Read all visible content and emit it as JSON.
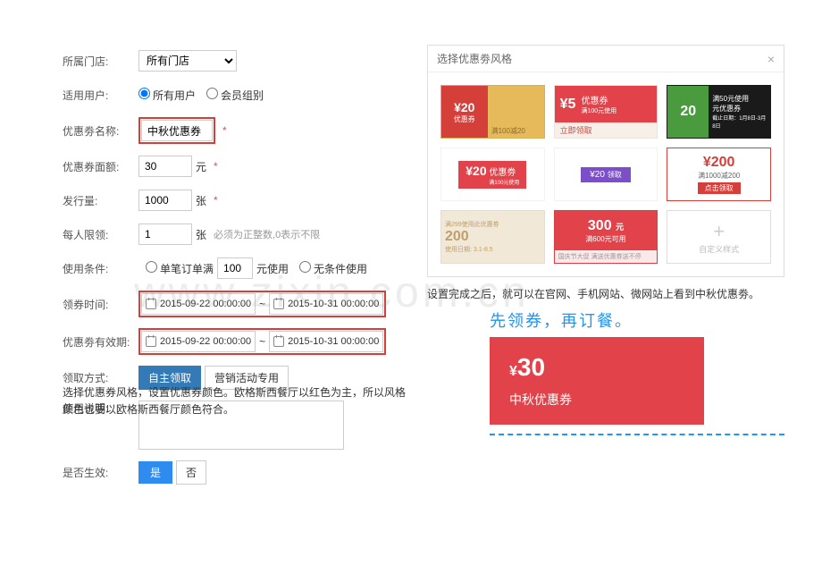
{
  "form": {
    "store": {
      "label": "所属门店:",
      "value": "所有门店"
    },
    "user": {
      "label": "适用用户:",
      "opt1": "所有用户",
      "opt2": "会员组别"
    },
    "name": {
      "label": "优惠劵名称:",
      "value": "中秋优惠券"
    },
    "face": {
      "label": "优惠券面额:",
      "value": "30",
      "unit": "元"
    },
    "qty": {
      "label": "发行量:",
      "value": "1000",
      "unit": "张"
    },
    "limit": {
      "label": "每人限领:",
      "value": "1",
      "unit": "张",
      "hint": "必须为正整数,0表示不限"
    },
    "cond": {
      "label": "使用条件:",
      "opt1": "单笔订单满",
      "val": "100",
      "unit": "元使用",
      "opt2": "无条件使用"
    },
    "claim": {
      "label": "领券时间:",
      "start": "2015-09-22 00:00:00",
      "end": "2015-10-31 00:00:00"
    },
    "valid": {
      "label": "优惠劵有效期:",
      "start": "2015-09-22 00:00:00",
      "end": "2015-10-31 00:00:00"
    },
    "method": {
      "label": "领取方式:",
      "opt1": "自主领取",
      "opt2": "营销活动专用"
    },
    "note": {
      "label": "使用说明:"
    },
    "active": {
      "label": "是否生效:",
      "opt1": "是",
      "opt2": "否"
    },
    "required": "*",
    "tilde": "~"
  },
  "left_desc": "选择优惠券风格，设置优惠券颜色。欧格斯西餐厅以红色为主，所以风格颜色也要以欧格斯西餐厅颜色符合。",
  "panel": {
    "title": "选择优惠劵风格",
    "cards": {
      "c1": {
        "amt": "¥20",
        "sub": "优惠券",
        "foot": "满100减20"
      },
      "c2": {
        "amt": "¥5",
        "title": "优惠券",
        "sub": "满100元使用",
        "btn": "立即领取"
      },
      "c3": {
        "amt": "20",
        "unit": "元优惠券",
        "sub1": "满50元使用",
        "sub2": "截止日期：1月8日-3月8日"
      },
      "c4": {
        "amt": "¥20",
        "title": "优惠劵",
        "sub": "满100元使用"
      },
      "c5": {
        "amt": "¥20",
        "sub": "领取"
      },
      "c6": {
        "amt": "¥200",
        "sub": "满1000减200",
        "btn": "点击领取"
      },
      "c7": {
        "top": "满299使用此优惠劵",
        "amt": "200",
        "sub": "使用日期: 3.1-8.5"
      },
      "c8": {
        "amt": "300",
        "unit": "元",
        "sub": "满600元可用",
        "foot": "国庆节大促 满送优惠券送不停"
      },
      "c9": {
        "label": "自定义样式"
      }
    }
  },
  "right_desc": "设置完成之后，就可以在官网、手机网站、微网站上看到中秋优惠劵。",
  "promo": {
    "title": "先领券，再订餐。",
    "amt": "30",
    "cur": "¥",
    "name": "中秋优惠券"
  },
  "watermark": "www.zixin.com.cn"
}
